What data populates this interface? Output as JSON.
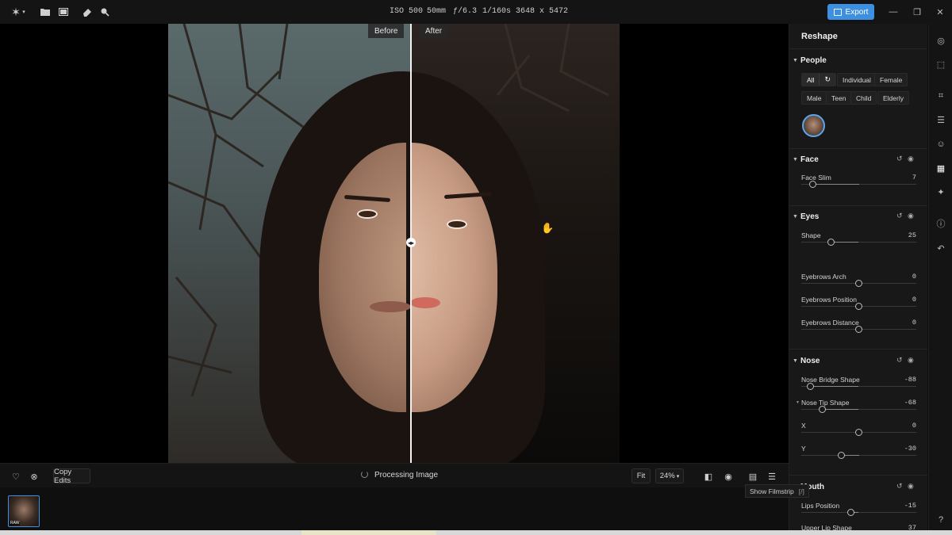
{
  "meta": {
    "iso": "ISO 500",
    "focal": "50mm",
    "aperture": "ƒ/6.3",
    "shutter": "1/160s",
    "dims": "3648 x 5472"
  },
  "toolbar": {
    "export_label": "Export"
  },
  "canvas": {
    "before_label": "Before",
    "after_label": "After"
  },
  "bottombar": {
    "copy_edits_label": "Copy Edits",
    "processing_label": "Processing Image",
    "fit_label": "Fit",
    "zoom_label": "24%"
  },
  "tooltip": {
    "text": "Show Filmstrip",
    "shortcut": "[/]"
  },
  "filmstrip": {
    "raw_badge": "RAW"
  },
  "panel": {
    "title": "Reshape",
    "people": {
      "title": "People",
      "chips_row1": [
        "All",
        "Individual",
        "Female"
      ],
      "chips_row2": [
        "Male",
        "Teen",
        "Child",
        "Elderly"
      ]
    },
    "face": {
      "title": "Face",
      "sliders": [
        {
          "label": "Face Slim",
          "value": "7",
          "norm": 0.1
        }
      ]
    },
    "eyes": {
      "title": "Eyes",
      "sliders": [
        {
          "label": "Shape",
          "value": "25",
          "norm": 0.26
        },
        {
          "label": "Eyebrows Arch",
          "value": "0",
          "norm": 0.5
        },
        {
          "label": "Eyebrows Position",
          "value": "0",
          "norm": 0.5
        },
        {
          "label": "Eyebrows Distance",
          "value": "0",
          "norm": 0.5
        }
      ]
    },
    "nose": {
      "title": "Nose",
      "sliders": [
        {
          "label": "Nose Bridge Shape",
          "value": "-88",
          "norm": 0.08
        },
        {
          "label": "Nose Tip Shape",
          "value": "-68",
          "norm": 0.18
        },
        {
          "label": "X",
          "value": "0",
          "norm": 0.5
        },
        {
          "label": "Y",
          "value": "-30",
          "norm": 0.35
        }
      ]
    },
    "mouth": {
      "title": "Mouth",
      "sliders": [
        {
          "label": "Lips Position",
          "value": "-15",
          "norm": 0.43
        },
        {
          "label": "Upper Lip Shape",
          "value": "37",
          "norm": 0.68
        }
      ]
    }
  }
}
